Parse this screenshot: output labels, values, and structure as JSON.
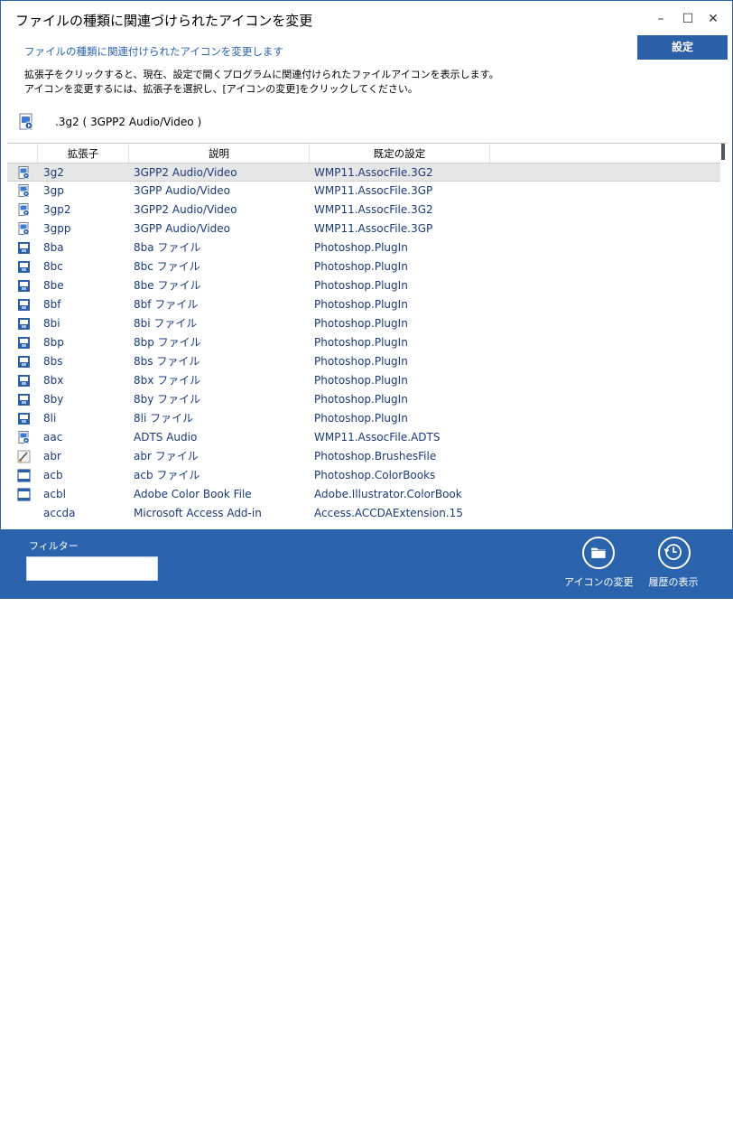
{
  "window": {
    "title": "ファイルの種類に関連づけられたアイコンを変更",
    "minimize": "–",
    "maximize": "☐",
    "close": "✕"
  },
  "header": {
    "subtitle": "ファイルの種類に関連付けられたアイコンを変更します",
    "settings_label": "設定",
    "desc_line1": "拡張子をクリックすると、現在、設定で開くプログラムに関連付けられたファイルアイコンを表示します。",
    "desc_line2": "アイコンを変更するには、拡張子を選択し、[アイコンの変更]をクリックしてください。"
  },
  "current": {
    "text": ".3g2 ( 3GPP2 Audio/Video )",
    "icon": "media-file-icon"
  },
  "table": {
    "columns": [
      "拡張子",
      "説明",
      "既定の設定"
    ],
    "rows": [
      {
        "ext": "3g2",
        "desc": "3GPP2 Audio/Video",
        "default": "WMP11.AssocFile.3G2",
        "icon": "media",
        "selected": true
      },
      {
        "ext": "3gp",
        "desc": "3GPP Audio/Video",
        "default": "WMP11.AssocFile.3GP",
        "icon": "media"
      },
      {
        "ext": "3gp2",
        "desc": "3GPP2 Audio/Video",
        "default": "WMP11.AssocFile.3G2",
        "icon": "media"
      },
      {
        "ext": "3gpp",
        "desc": "3GPP Audio/Video",
        "default": "WMP11.AssocFile.3GP",
        "icon": "media"
      },
      {
        "ext": "8ba",
        "desc": "8ba ファイル",
        "default": "Photoshop.PlugIn",
        "icon": "plugin"
      },
      {
        "ext": "8bc",
        "desc": "8bc ファイル",
        "default": "Photoshop.PlugIn",
        "icon": "plugin"
      },
      {
        "ext": "8be",
        "desc": "8be ファイル",
        "default": "Photoshop.PlugIn",
        "icon": "plugin"
      },
      {
        "ext": "8bf",
        "desc": "8bf ファイル",
        "default": "Photoshop.PlugIn",
        "icon": "plugin"
      },
      {
        "ext": "8bi",
        "desc": "8bi ファイル",
        "default": "Photoshop.PlugIn",
        "icon": "plugin"
      },
      {
        "ext": "8bp",
        "desc": "8bp ファイル",
        "default": "Photoshop.PlugIn",
        "icon": "plugin"
      },
      {
        "ext": "8bs",
        "desc": "8bs ファイル",
        "default": "Photoshop.PlugIn",
        "icon": "plugin"
      },
      {
        "ext": "8bx",
        "desc": "8bx ファイル",
        "default": "Photoshop.PlugIn",
        "icon": "plugin"
      },
      {
        "ext": "8by",
        "desc": "8by ファイル",
        "default": "Photoshop.PlugIn",
        "icon": "plugin"
      },
      {
        "ext": "8li",
        "desc": "8li ファイル",
        "default": "Photoshop.PlugIn",
        "icon": "plugin"
      },
      {
        "ext": "aac",
        "desc": "ADTS Audio",
        "default": "WMP11.AssocFile.ADTS",
        "icon": "media"
      },
      {
        "ext": "abr",
        "desc": "abr ファイル",
        "default": "Photoshop.BrushesFile",
        "icon": "brush"
      },
      {
        "ext": "acb",
        "desc": "acb ファイル",
        "default": "Photoshop.ColorBooks",
        "icon": "window"
      },
      {
        "ext": "acbl",
        "desc": "Adobe Color Book File",
        "default": "Adobe.Illustrator.ColorBook",
        "icon": "window"
      },
      {
        "ext": "accda",
        "desc": "Microsoft Access Add-in",
        "default": "Access.ACCDAExtension.15",
        "icon": "none"
      }
    ]
  },
  "footer": {
    "filter_label": "フィルター",
    "filter_value": "",
    "change_icon_label": "アイコンの変更",
    "history_label": "履歴の表示",
    "grip": "⋰"
  },
  "colors": {
    "accent": "#2b63ad",
    "settings_bg": "#2b5fa8",
    "text_blue": "#1a3a78",
    "selected_row": "#e6e6e6"
  }
}
